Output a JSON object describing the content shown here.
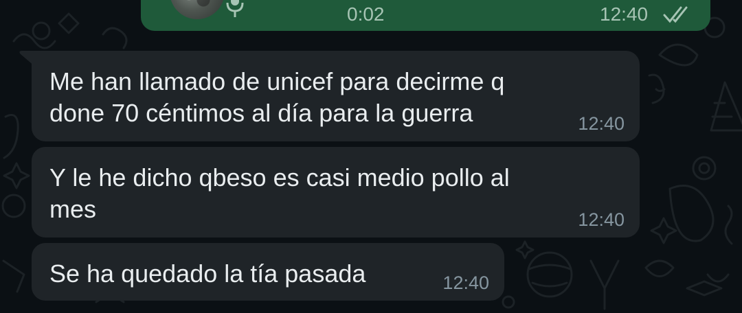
{
  "voice_message": {
    "duration": "0:02",
    "time": "12:40",
    "status": "read",
    "bubble_color": "#1f5a3a"
  },
  "messages": [
    {
      "line1": "Me han llamado de unicef para decirme q",
      "line2": "done 70 céntimos al día para la guerra",
      "time": "12:40"
    },
    {
      "line1": "Y le he dicho qbeso es casi medio pollo al",
      "line2": "mes",
      "time": "12:40"
    },
    {
      "line1": "Se ha quedado la tía pasada",
      "time": "12:40"
    }
  ],
  "colors": {
    "background": "#0b1014",
    "incoming_bubble": "#1f2428",
    "text": "#e9edef",
    "meta": "#8696a0"
  },
  "icons": [
    "microphone-icon",
    "double-check-icon"
  ]
}
